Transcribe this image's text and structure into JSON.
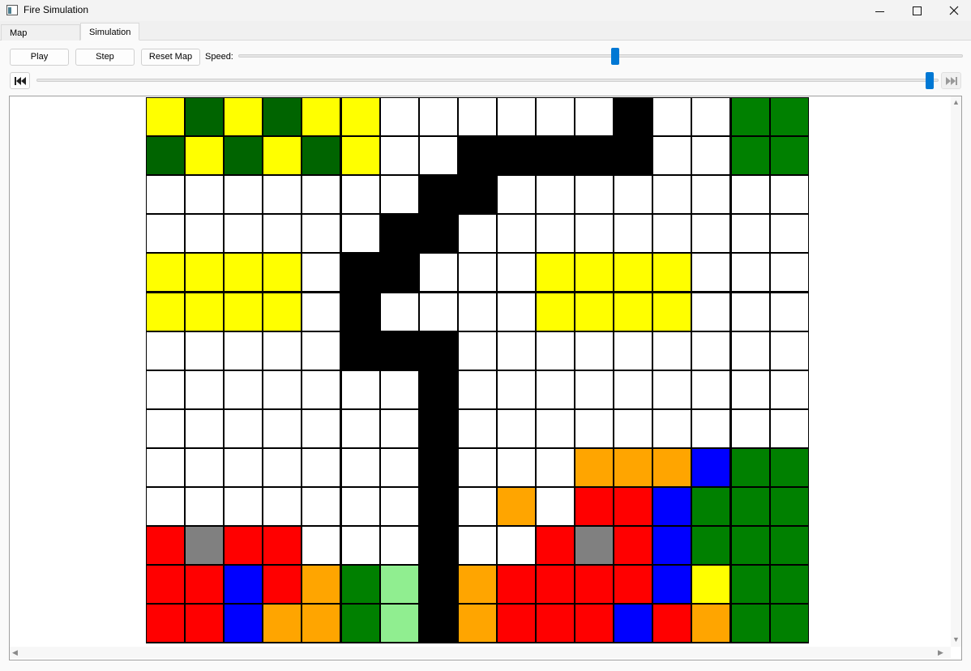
{
  "window": {
    "title": "Fire Simulation",
    "controls": [
      "minimize",
      "maximize",
      "close"
    ]
  },
  "tabs": [
    {
      "label": "Map Generation",
      "active": false
    },
    {
      "label": "Simulation",
      "active": true
    }
  ],
  "toolbar": {
    "play_label": "Play",
    "step_label": "Step",
    "reset_label": "Reset Map",
    "speed_label": "Speed:",
    "speed_value": 0.52
  },
  "timeline": {
    "first_icon": "skip-to-start-icon",
    "last_icon": "skip-to-end-icon",
    "position": 1.0
  },
  "colors": {
    "W": "#ffffff",
    "K": "#000000",
    "Y": "#ffff00",
    "D": "#006400",
    "G": "#008000",
    "L": "#90ee90",
    "R": "#ff0000",
    "O": "#ffa500",
    "B": "#0000ff",
    "A": "#808080",
    "accent": "#0078d4"
  },
  "legend_codes": {
    "W": "empty",
    "K": "black",
    "Y": "yellow",
    "D": "dark green",
    "G": "green",
    "L": "light green",
    "R": "red",
    "O": "orange",
    "B": "blue",
    "A": "gray"
  },
  "map": {
    "cols": 17,
    "rows": 14,
    "cells": [
      "YDYDYYWWWWWWKWWGG",
      "DYDYDYWWKKKKKWWGG",
      "WWWWWWWKKWWWWWWWW",
      "WWWWWWKKWWWWWWWWW",
      "YYYYWKKWWWYYYYWWW",
      "YYYYWKWWWWYYYYWWW",
      "WWWWWKKKWWWWWWWWW",
      "WWWWWWWKWWWWWWWWW",
      "WWWWWWWKWWWWWWWWW",
      "WWWWWWWKWWWOOOBGG",
      "WWWWWWWKWOWRRBGGG",
      "RARRWWWKWWRARBGGG",
      "RRBROGLKORRRRBYGG",
      "RRBOOGLKORRRBROGG"
    ]
  }
}
